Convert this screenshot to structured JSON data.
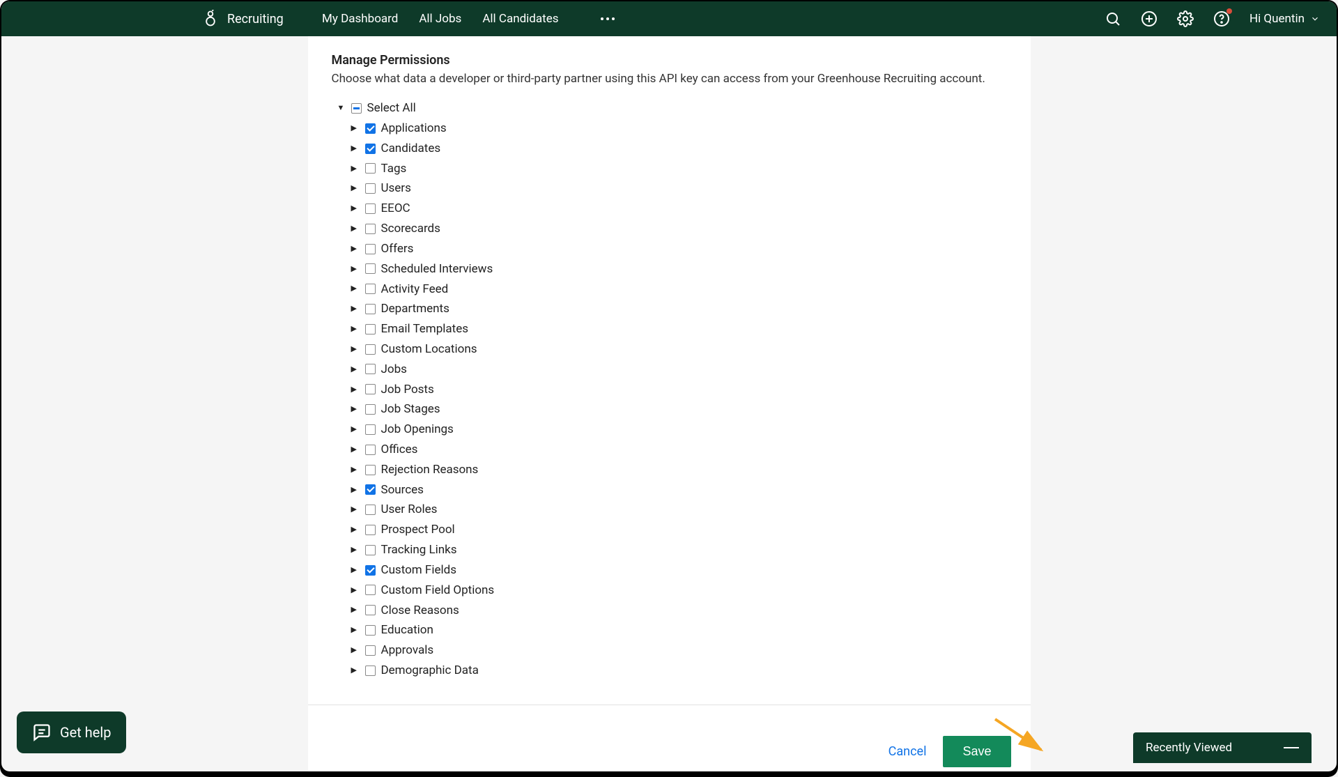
{
  "topnav": {
    "brand": "Recruiting",
    "links": {
      "my_dashboard": "My Dashboard",
      "all_jobs": "All Jobs",
      "all_candidates": "All Candidates"
    },
    "user_greeting": "Hi Quentin"
  },
  "permissions": {
    "title": "Manage Permissions",
    "description": "Choose what data a developer or third-party partner using this API key can access from your Greenhouse Recruiting account.",
    "select_all_label": "Select All",
    "items": [
      {
        "label": "Applications",
        "checked": true
      },
      {
        "label": "Candidates",
        "checked": true
      },
      {
        "label": "Tags",
        "checked": false
      },
      {
        "label": "Users",
        "checked": false
      },
      {
        "label": "EEOC",
        "checked": false
      },
      {
        "label": "Scorecards",
        "checked": false
      },
      {
        "label": "Offers",
        "checked": false
      },
      {
        "label": "Scheduled Interviews",
        "checked": false
      },
      {
        "label": "Activity Feed",
        "checked": false
      },
      {
        "label": "Departments",
        "checked": false
      },
      {
        "label": "Email Templates",
        "checked": false
      },
      {
        "label": "Custom Locations",
        "checked": false
      },
      {
        "label": "Jobs",
        "checked": false
      },
      {
        "label": "Job Posts",
        "checked": false
      },
      {
        "label": "Job Stages",
        "checked": false
      },
      {
        "label": "Job Openings",
        "checked": false
      },
      {
        "label": "Offices",
        "checked": false
      },
      {
        "label": "Rejection Reasons",
        "checked": false
      },
      {
        "label": "Sources",
        "checked": true
      },
      {
        "label": "User Roles",
        "checked": false
      },
      {
        "label": "Prospect Pool",
        "checked": false
      },
      {
        "label": "Tracking Links",
        "checked": false
      },
      {
        "label": "Custom Fields",
        "checked": true
      },
      {
        "label": "Custom Field Options",
        "checked": false
      },
      {
        "label": "Close Reasons",
        "checked": false
      },
      {
        "label": "Education",
        "checked": false
      },
      {
        "label": "Approvals",
        "checked": false
      },
      {
        "label": "Demographic Data",
        "checked": false
      }
    ]
  },
  "actions": {
    "cancel": "Cancel",
    "save": "Save"
  },
  "widgets": {
    "get_help": "Get help",
    "recently_viewed": "Recently Viewed"
  }
}
